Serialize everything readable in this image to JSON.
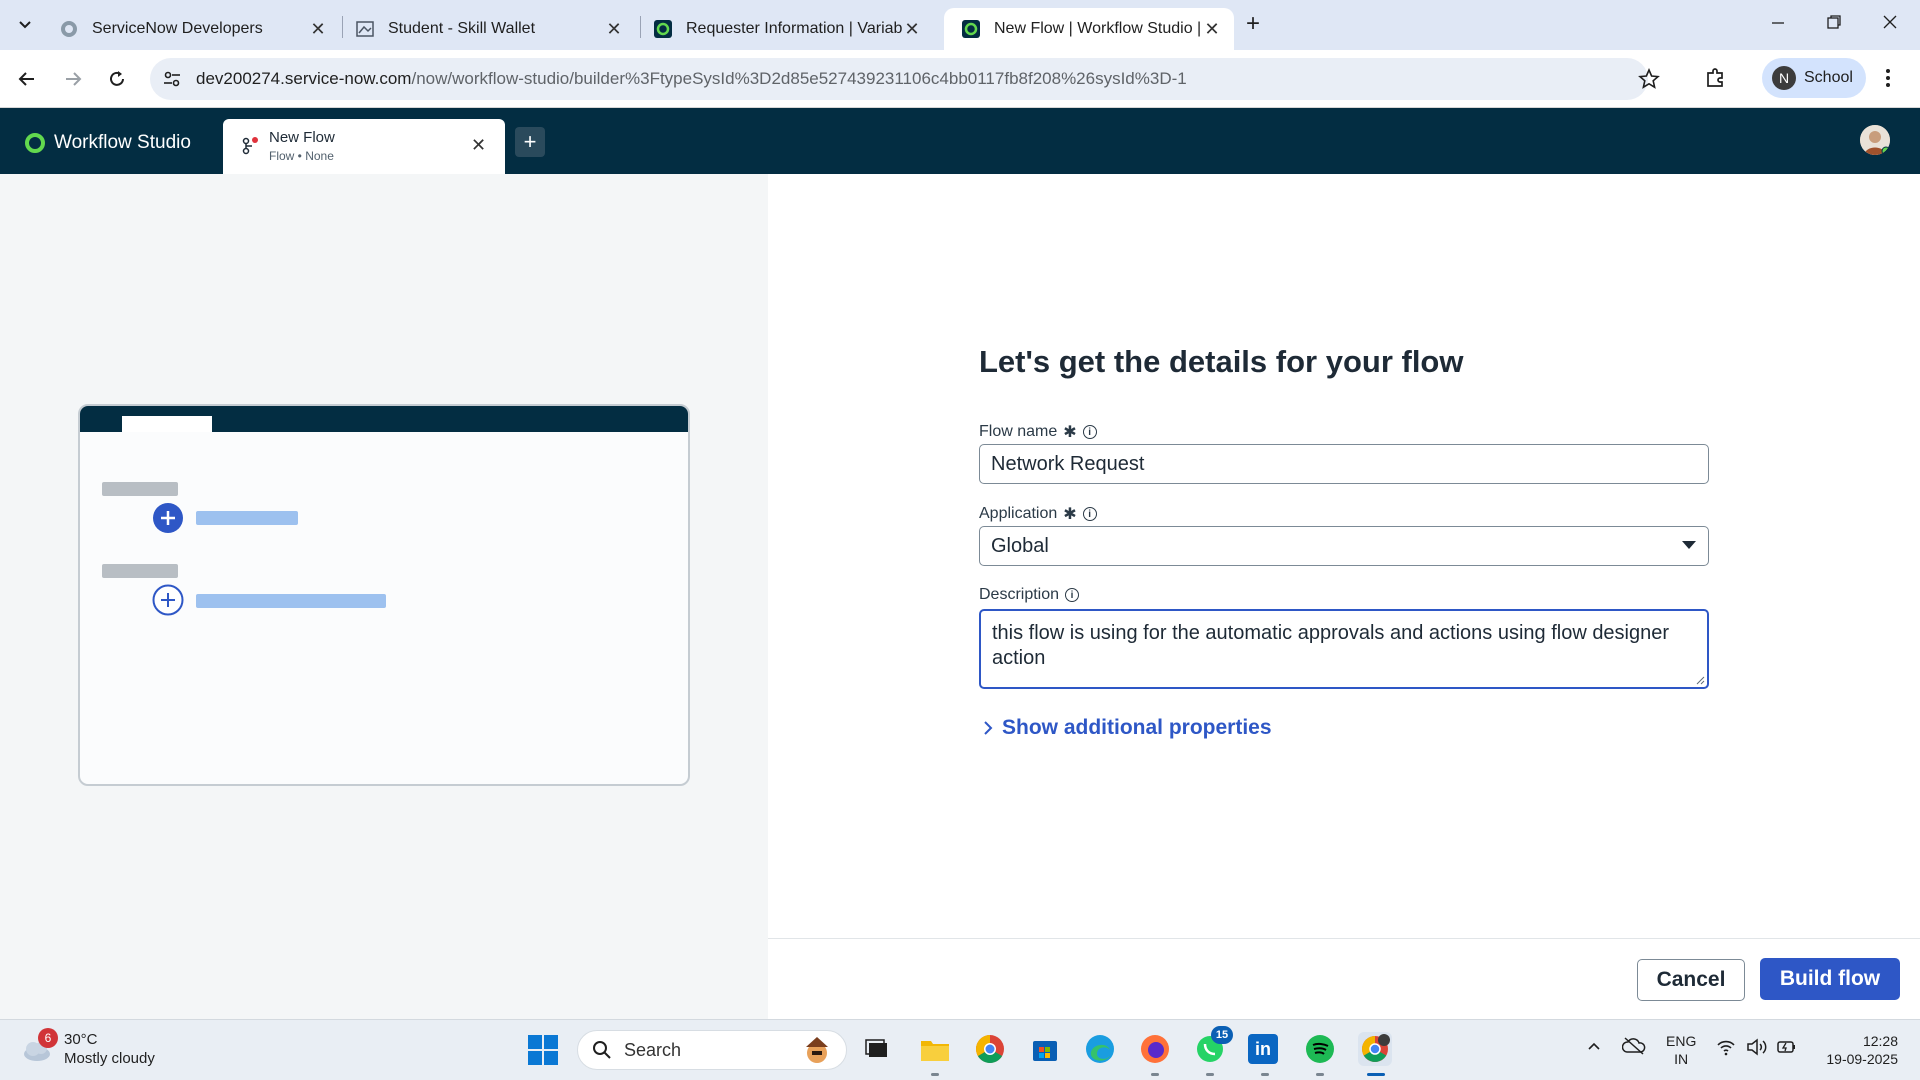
{
  "browser": {
    "tabs": [
      {
        "title": "ServiceNow Developers"
      },
      {
        "title": "Student - Skill Wallet"
      },
      {
        "title": "Requester Information | Variable"
      },
      {
        "title": "New Flow | Workflow Studio | ServiceNow"
      }
    ],
    "url_host": "dev200274.service-now.com",
    "url_path": "/now/workflow-studio/builder%3FtypeSysId%3D2d85e527439231106c4bb0117fb8f208%26sysId%3D-1",
    "profile_initial": "N",
    "profile_label": "School"
  },
  "app": {
    "name": "Workflow Studio",
    "flow_tab": {
      "title": "New Flow",
      "subtitle": "Flow • None"
    }
  },
  "form": {
    "heading": "Let's get the details for your flow",
    "flow_name_label": "Flow name",
    "flow_name_value": "Network Request",
    "application_label": "Application",
    "application_value": "Global",
    "description_label": "Description",
    "description_value": "this flow is using for the automatic approvals and actions using flow designer action",
    "show_props_label": "Show additional properties",
    "cancel_label": "Cancel",
    "build_label": "Build flow"
  },
  "taskbar": {
    "weather_badge": "6",
    "temperature": "30°C",
    "weather_text": "Mostly cloudy",
    "search_label": "Search",
    "whatsapp_badge": "15",
    "lang_line1": "ENG",
    "lang_line2": "IN",
    "time": "12:28",
    "date": "19-09-2025"
  },
  "colors": {
    "header_bg": "#032d42",
    "primary": "#2e57c6",
    "brand_green": "#62d84e"
  }
}
